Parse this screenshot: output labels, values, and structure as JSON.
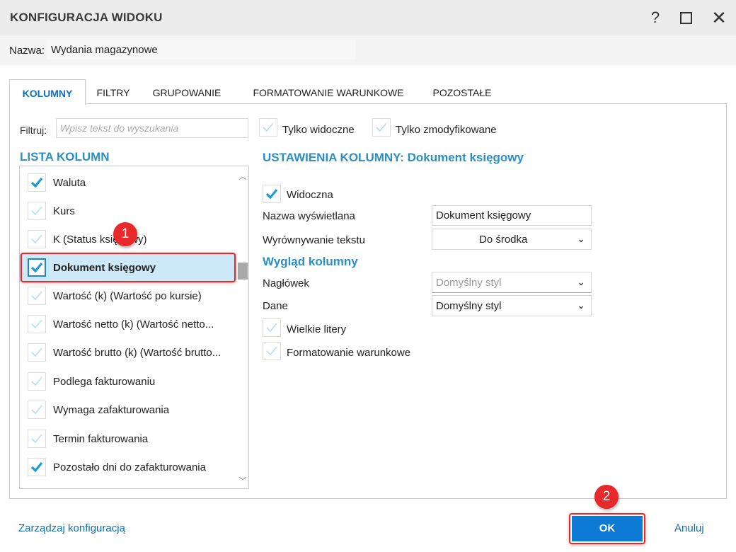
{
  "window": {
    "title": "KONFIGURACJA WIDOKU",
    "help_icon": "?",
    "close_icon": "✕"
  },
  "name": {
    "label": "Nazwa:",
    "value": "Wydania magazynowe"
  },
  "tabs": [
    {
      "label": "KOLUMNY",
      "active": true
    },
    {
      "label": "FILTRY",
      "active": false
    },
    {
      "label": "GRUPOWANIE",
      "active": false
    },
    {
      "label": "FORMATOWANIE WARUNKOWE",
      "active": false
    },
    {
      "label": "POZOSTAŁE",
      "active": false
    }
  ],
  "filter": {
    "label": "Filtruj:",
    "placeholder": "Wpisz tekst do wyszukania",
    "only_visible": {
      "label": "Tylko widoczne",
      "checked": false
    },
    "only_modified": {
      "label": "Tylko zmodyfikowane",
      "checked": false
    }
  },
  "column_list": {
    "title": "LISTA KOLUMN",
    "items": [
      {
        "label": "Waluta",
        "checked": true,
        "selected": false
      },
      {
        "label": "Kurs",
        "checked": false,
        "selected": false
      },
      {
        "label": "K (Status księgowy)",
        "checked": false,
        "selected": false
      },
      {
        "label": "Dokument księgowy",
        "checked": true,
        "selected": true
      },
      {
        "label": "Wartość (k) (Wartość po kursie)",
        "checked": false,
        "selected": false
      },
      {
        "label": "Wartość netto (k) (Wartość netto...",
        "checked": false,
        "selected": false
      },
      {
        "label": "Wartość brutto (k) (Wartość brutto...",
        "checked": false,
        "selected": false
      },
      {
        "label": "Podlega fakturowaniu",
        "checked": false,
        "selected": false
      },
      {
        "label": "Wymaga zafakturowania",
        "checked": false,
        "selected": false
      },
      {
        "label": "Termin fakturowania",
        "checked": false,
        "selected": false
      },
      {
        "label": "Pozostało dni do zafakturowania",
        "checked": true,
        "selected": false
      }
    ]
  },
  "column_settings": {
    "title": "USTAWIENIA KOLUMNY: Dokument księgowy",
    "visible": {
      "label": "Widoczna",
      "checked": true
    },
    "display_name": {
      "label": "Nazwa wyświetlana",
      "value": "Dokument księgowy"
    },
    "text_align": {
      "label": "Wyrównywanie tekstu",
      "value": "Do środka"
    },
    "appearance_title": "Wygląd kolumny",
    "header_style": {
      "label": "Nagłówek",
      "value": "Domyślny styl"
    },
    "data_style": {
      "label": "Dane",
      "value": "Domyślny styl"
    },
    "uppercase": {
      "label": "Wielkie litery",
      "checked": false
    },
    "conditional_formatting": {
      "label": "Formatowanie warunkowe",
      "checked": false
    }
  },
  "markers": {
    "first": "1",
    "second": "2"
  },
  "footer": {
    "manage_label": "Zarządzaj konfiguracją",
    "ok_label": "OK",
    "cancel_label": "Anuluj"
  },
  "colors": {
    "accent": "#2b8fc6",
    "primary_button": "#0d7bd6",
    "marker": "#e8292b",
    "selection": "#cde8f6"
  }
}
